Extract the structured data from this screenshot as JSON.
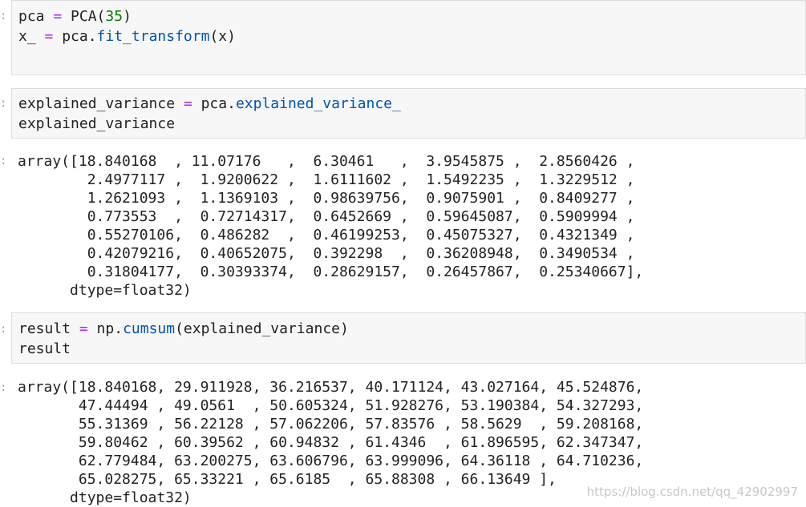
{
  "cells": [
    {
      "type": "code",
      "lines": [
        {
          "segments": [
            {
              "t": "pca ",
              "c": ""
            },
            {
              "t": "=",
              "c": "op"
            },
            {
              "t": " PCA(",
              "c": ""
            },
            {
              "t": "35",
              "c": "num"
            },
            {
              "t": ")",
              "c": ""
            }
          ]
        },
        {
          "segments": [
            {
              "t": "x_ ",
              "c": ""
            },
            {
              "t": "=",
              "c": "op"
            },
            {
              "t": " pca.",
              "c": ""
            },
            {
              "t": "fit_transform",
              "c": "attr"
            },
            {
              "t": "(x)",
              "c": ""
            }
          ]
        }
      ]
    },
    {
      "type": "code",
      "lines": [
        {
          "segments": [
            {
              "t": "explained_variance ",
              "c": ""
            },
            {
              "t": "=",
              "c": "op"
            },
            {
              "t": " pca.",
              "c": ""
            },
            {
              "t": "explained_variance_",
              "c": "attr"
            }
          ]
        },
        {
          "segments": [
            {
              "t": "explained_variance",
              "c": ""
            }
          ]
        }
      ]
    },
    {
      "type": "output",
      "lines": [
        "array([18.840168  , 11.07176   ,  6.30461   ,  3.9545875 ,  2.8560426 ,",
        "        2.4977117 ,  1.9200622 ,  1.6111602 ,  1.5492235 ,  1.3229512 ,",
        "        1.2621093 ,  1.1369103 ,  0.98639756,  0.9075901 ,  0.8409277 ,",
        "        0.773553  ,  0.72714317,  0.6452669 ,  0.59645087,  0.5909994 ,",
        "        0.55270106,  0.486282  ,  0.46199253,  0.45075327,  0.4321349 ,",
        "        0.42079216,  0.40652075,  0.392298  ,  0.36208948,  0.3490534 ,",
        "        0.31804177,  0.30393374,  0.28629157,  0.26457867,  0.25340667],",
        "      dtype=float32)"
      ]
    },
    {
      "type": "code",
      "lines": [
        {
          "segments": [
            {
              "t": "result ",
              "c": ""
            },
            {
              "t": "=",
              "c": "op"
            },
            {
              "t": " np.",
              "c": ""
            },
            {
              "t": "cumsum",
              "c": "attr"
            },
            {
              "t": "(explained_variance)",
              "c": ""
            }
          ]
        },
        {
          "segments": [
            {
              "t": "result",
              "c": ""
            }
          ]
        }
      ]
    },
    {
      "type": "output",
      "lines": [
        "array([18.840168, 29.911928, 36.216537, 40.171124, 43.027164, 45.524876,",
        "       47.44494 , 49.0561  , 50.605324, 51.928276, 53.190384, 54.327293,",
        "       55.31369 , 56.22128 , 57.062206, 57.83576 , 58.5629  , 59.208168,",
        "       59.80462 , 60.39562 , 60.94832 , 61.4346  , 61.896595, 62.347347,",
        "       62.779484, 63.200275, 63.606796, 63.999096, 64.36118 , 64.710236,",
        "       65.028275, 65.33221 , 65.6185  , 65.88308 , 66.13649 ],",
        "      dtype=float32)"
      ]
    }
  ],
  "watermark": "https://blog.csdn.net/qq_42902997",
  "prompt_marker": ":"
}
